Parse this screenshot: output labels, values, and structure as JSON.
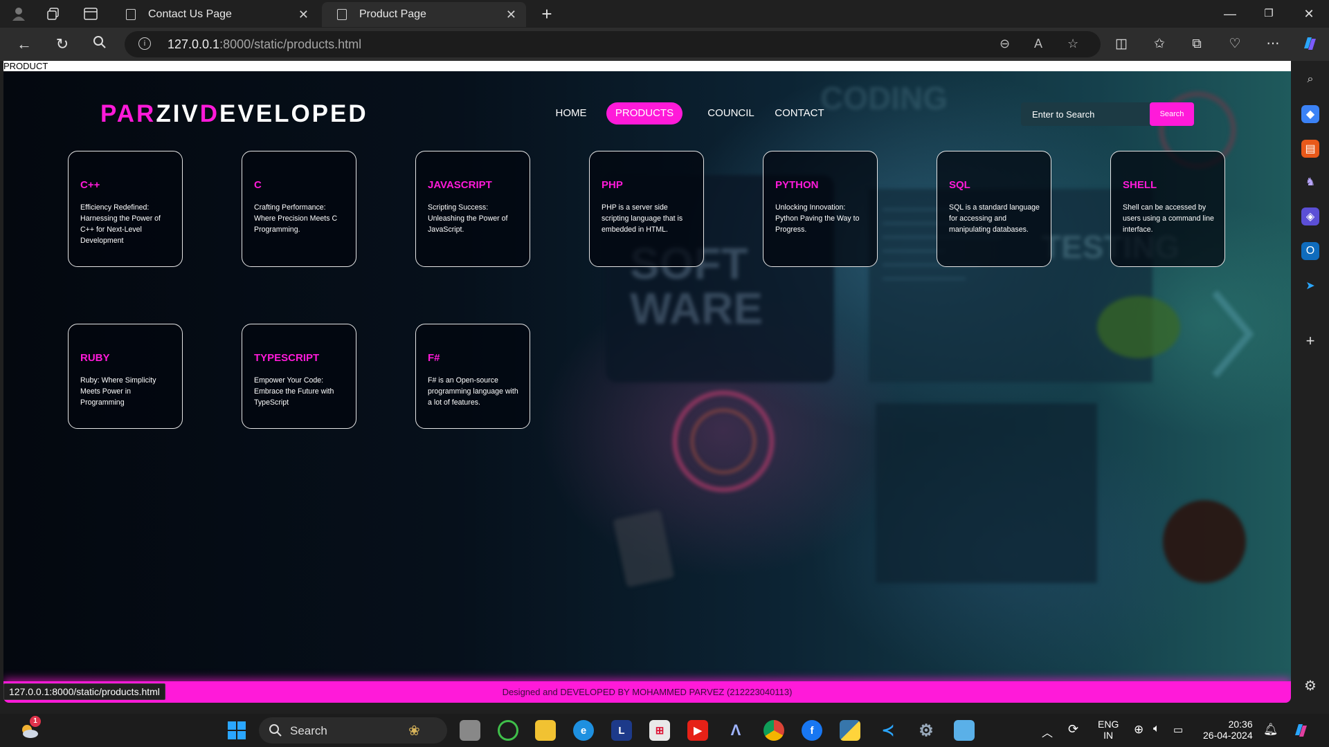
{
  "browser": {
    "tabs": [
      {
        "title": "Contact Us Page",
        "active": false
      },
      {
        "title": "Product Page",
        "active": true
      }
    ],
    "url_host": "127.0.0.1",
    "url_path": ":8000/static/products.html",
    "status_url": "127.0.0.1:8000/static/products.html"
  },
  "page": {
    "top_label": "PRODUCT",
    "logo": {
      "part1": "PAR",
      "part2": "ZIV",
      "part3": "D",
      "part4": "EVELOPED"
    },
    "nav": [
      {
        "label": "HOME",
        "active": false
      },
      {
        "label": "PRODUCTS",
        "active": true
      },
      {
        "label": "COUNCIL",
        "active": false
      },
      {
        "label": "CONTACT",
        "active": false
      }
    ],
    "search": {
      "placeholder": "Enter to Search",
      "button": "Search"
    },
    "cards": [
      {
        "title": "C++",
        "text": "Efficiency Redefined: Harnessing the Power of C++ for Next-Level Development"
      },
      {
        "title": "C",
        "text": "Crafting Performance: Where Precision Meets C Programming."
      },
      {
        "title": "JAVASCRIPT",
        "text": "Scripting Success: Unleashing the Power of JavaScript."
      },
      {
        "title": "PHP",
        "text": "PHP is a server side scripting language that is embedded in HTML."
      },
      {
        "title": "PYTHON",
        "text": "Unlocking Innovation: Python Paving the Way to Progress."
      },
      {
        "title": "SQL",
        "text": "SQL is a standard language for accessing and manipulating databases."
      },
      {
        "title": "SHELL",
        "text": "Shell can be accessed by users using a command line interface."
      },
      {
        "title": "RUBY",
        "text": "Ruby: Where Simplicity Meets Power in Programming"
      },
      {
        "title": "TYPESCRIPT",
        "text": "Empower Your Code: Embrace the Future with TypeScript"
      },
      {
        "title": "F#",
        "text": "F# is an Open-source programming language with a lot of features."
      }
    ],
    "footer": "Designed and DEVELOPED BY MOHAMMED PARVEZ (212223040113)"
  },
  "taskbar": {
    "search_label": "Search",
    "weather_badge": "1",
    "lang": "ENG",
    "region": "IN",
    "time": "20:36",
    "date": "26-04-2024",
    "l_app": "L"
  },
  "colors": {
    "accent": "#ff1ad9",
    "chrome": "#202020",
    "toolbar": "#2d2d2d"
  }
}
